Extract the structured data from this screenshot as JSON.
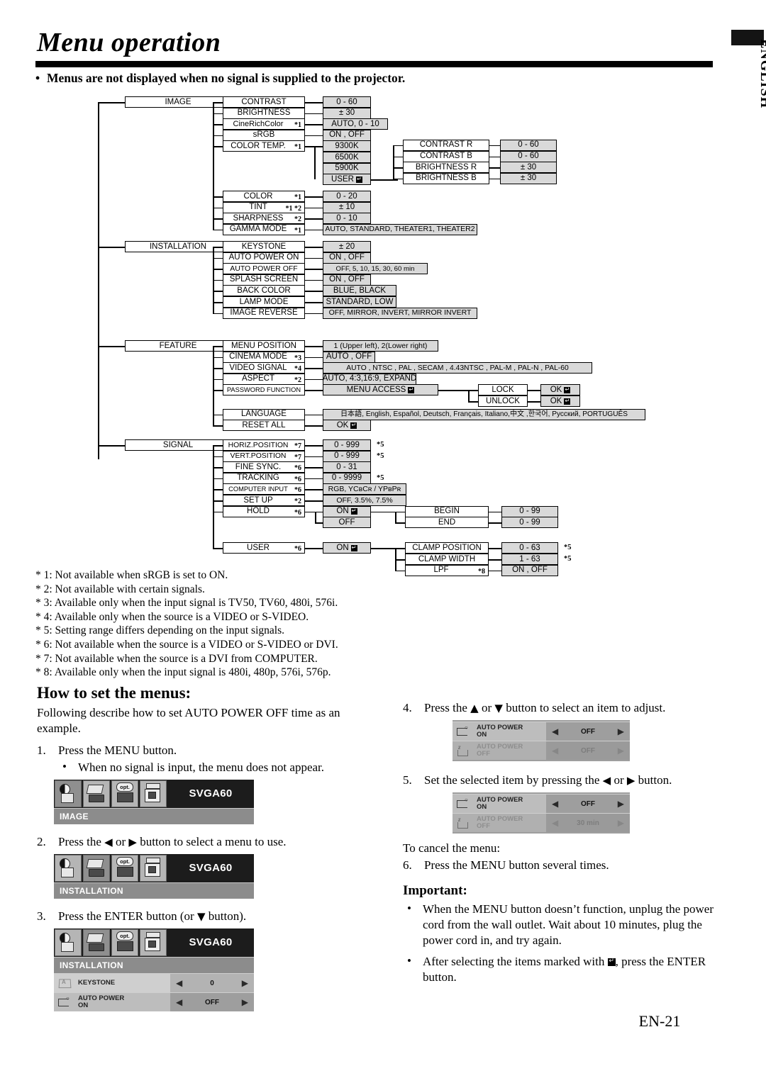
{
  "header": {
    "title": "Menu operation",
    "language_tab": "ENGLISH",
    "intro_bullet": "Menus are not displayed when no signal is supplied to the projector."
  },
  "tree": {
    "image": {
      "root": "IMAGE",
      "items": [
        {
          "label": "CONTRAST",
          "note": "",
          "value": "0 - 60"
        },
        {
          "label": "BRIGHTNESS",
          "note": "",
          "value": "± 30"
        },
        {
          "label": "CineRichColor",
          "note": "*1",
          "value": "AUTO, 0 - 10"
        },
        {
          "label": "sRGB",
          "note": "",
          "value": "ON , OFF"
        },
        {
          "label": "COLOR TEMP.",
          "note": "*1",
          "value": "9300K"
        },
        {
          "label": "",
          "note": "",
          "value": "6500K"
        },
        {
          "label": "",
          "note": "",
          "value": "5900K"
        },
        {
          "label": "",
          "note": "",
          "value": "USER"
        },
        {
          "label": "COLOR",
          "note": "*1",
          "value": "0 - 20"
        },
        {
          "label": "TINT",
          "note": "*1 *2",
          "value": "± 10"
        },
        {
          "label": "SHARPNESS",
          "note": "*2",
          "value": "0 - 10"
        },
        {
          "label": "GAMMA MODE",
          "note": "*1",
          "value": "AUTO, STANDARD, THEATER1, THEATER2"
        }
      ],
      "user_sub": [
        {
          "label": "CONTRAST R",
          "value": "0 - 60"
        },
        {
          "label": "CONTRAST B",
          "value": "0 - 60"
        },
        {
          "label": "BRIGHTNESS R",
          "value": "± 30"
        },
        {
          "label": "BRIGHTNESS B",
          "value": "± 30"
        }
      ]
    },
    "installation": {
      "root": "INSTALLATION",
      "items": [
        {
          "label": "KEYSTONE",
          "note": "",
          "value": "± 20"
        },
        {
          "label": "AUTO POWER ON",
          "note": "",
          "value": "ON , OFF"
        },
        {
          "label": "AUTO POWER OFF",
          "note": "",
          "value": "OFF,  5,  10,  15,  30,  60 min"
        },
        {
          "label": "SPLASH SCREEN",
          "note": "",
          "value": "ON , OFF"
        },
        {
          "label": "BACK COLOR",
          "note": "",
          "value": "BLUE, BLACK"
        },
        {
          "label": "LAMP MODE",
          "note": "",
          "value": "STANDARD, LOW"
        },
        {
          "label": "IMAGE REVERSE",
          "note": "",
          "value": "OFF, MIRROR, INVERT, MIRROR INVERT"
        }
      ]
    },
    "feature": {
      "root": "FEATURE",
      "items": [
        {
          "label": "MENU POSITION",
          "note": "",
          "value": "1 (Upper left), 2(Lower right)"
        },
        {
          "label": "CINEMA MODE",
          "note": "*3",
          "value": "AUTO , OFF"
        },
        {
          "label": "VIDEO SIGNAL",
          "note": "*4",
          "value": "AUTO , NTSC , PAL , SECAM , 4.43NTSC , PAL-M , PAL-N , PAL-60"
        },
        {
          "label": "ASPECT",
          "note": "*2",
          "value": "AUTO, 4:3,16:9, EXPAND"
        },
        {
          "label": "PASSWORD FUNCTION",
          "note": "",
          "value": "MENU ACCESS"
        },
        {
          "label": "LANGUAGE",
          "note": "",
          "value": "日本語, English, Español, Deutsch, Français, Italiano,中文 ,한국어, Русский, PORTUGUÊS"
        },
        {
          "label": "RESET ALL",
          "note": "",
          "value": "OK"
        }
      ],
      "password_sub": [
        {
          "label": "LOCK",
          "value": "OK"
        },
        {
          "label": "UNLOCK",
          "value": "OK"
        }
      ]
    },
    "signal": {
      "root": "SIGNAL",
      "items": [
        {
          "label": "HORIZ.POSITION",
          "note": "*7",
          "value": "0 - 999",
          "tail": "*5"
        },
        {
          "label": "VERT.POSITION",
          "note": "*7",
          "value": "0 - 999",
          "tail": "*5"
        },
        {
          "label": "FINE SYNC.",
          "note": "*6",
          "value": "0 - 31",
          "tail": ""
        },
        {
          "label": "TRACKING",
          "note": "*6",
          "value": "0 - 9999",
          "tail": "*5"
        },
        {
          "label": "COMPUTER INPUT",
          "note": "*6",
          "value": "RGB, YCʙCʀ / YPʙPʀ",
          "tail": ""
        },
        {
          "label": "SET UP",
          "note": "*2",
          "value": "OFF, 3.5%, 7.5%",
          "tail": ""
        },
        {
          "label": "HOLD",
          "note": "*6",
          "value": "ON",
          "tail": ""
        },
        {
          "label": "",
          "note": "",
          "value": "OFF",
          "tail": ""
        },
        {
          "label": "USER",
          "note": "*6",
          "value": "ON",
          "tail": ""
        }
      ],
      "hold_sub": [
        {
          "label": "BEGIN",
          "value": "0 - 99",
          "tail": ""
        },
        {
          "label": "END",
          "value": "0 - 99",
          "tail": ""
        }
      ],
      "user_sub": [
        {
          "label": "CLAMP POSITION",
          "note": "",
          "value": "0 - 63",
          "tail": "*5"
        },
        {
          "label": "CLAMP WIDTH",
          "note": "",
          "value": "1 - 63",
          "tail": "*5"
        },
        {
          "label": "LPF",
          "note": "*8",
          "value": "ON , OFF",
          "tail": ""
        }
      ]
    }
  },
  "footnotes": [
    "* 1: Not available when sRGB is set to ON.",
    "* 2: Not available with certain signals.",
    "* 3: Available only when the input signal is TV50, TV60, 480i, 576i.",
    "* 4: Available only when the source is a VIDEO or S-VIDEO.",
    "* 5: Setting range differs depending on the input signals.",
    "* 6: Not available when the source is a VIDEO or S-VIDEO or DVI.",
    "* 7: Not available when the source is a DVI from COMPUTER.",
    "* 8: Available only when the input signal is 480i, 480p, 576i, 576p."
  ],
  "how_to": {
    "heading": "How to set the menus:",
    "intro": "Following describe how to set AUTO POWER OFF time as an example.",
    "step1_num": "1.",
    "step1": "Press the MENU button.",
    "step1_sub": "When no signal is input, the menu does not appear.",
    "step2_num": "2.",
    "step2_a": "Press the",
    "step2_b": "or",
    "step2_c": "button to select a menu to use.",
    "step3_num": "3.",
    "step3_a": "Press the ENTER button (or",
    "step3_b": "button)."
  },
  "right": {
    "step4_num": "4.",
    "step4_a": "Press the",
    "step4_b": "or",
    "step4_c": "button to select an item to adjust.",
    "step5_num": "5.",
    "step5_a": "Set the selected item by pressing the",
    "step5_b": "or",
    "step5_c": "button.",
    "cancel_heading": "To cancel the menu:",
    "step6_num": "6.",
    "step6": "Press the MENU button several times.",
    "important_heading": "Important:",
    "important_1": "When the MENU button doesn’t function, unplug the power cord from the wall outlet. Wait about 10 minutes, plug the power cord in, and try again.",
    "important_2a": "After selecting the items marked with",
    "important_2b": ", press the ENTER button."
  },
  "osd": {
    "signal_label": "SVGA60",
    "menu_image": "IMAGE",
    "menu_installation": "INSTALLATION",
    "row_keystone_label": "KEYSTONE",
    "row_keystone_value": "0",
    "row_apon_label1": "AUTO POWER",
    "row_apon_label2": "ON",
    "row_apon_value": "OFF",
    "row_apoff_label1": "AUTO POWER",
    "row_apoff_label2": "OFF",
    "row_apoff_value_step4": "OFF",
    "row_apoff_value_step5": "30 min"
  },
  "page_number": "EN-21"
}
